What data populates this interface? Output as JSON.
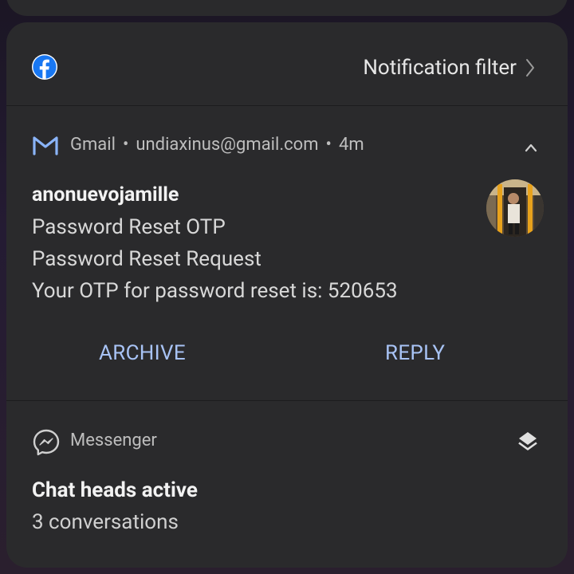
{
  "facebook_notification": {
    "app_icon": "facebook-icon",
    "filter_label": "Notification filter",
    "filter_icon": "chevron-right-icon"
  },
  "gmail_notification": {
    "app_icon": "gmail-icon",
    "app_name": "Gmail",
    "separator": "•",
    "account": "undiaxinus@gmail.com",
    "time": "4m",
    "collapse_icon": "chevron-up-icon",
    "sender": "anonuevojamille",
    "subject": "Password Reset OTP",
    "title_line": "Password Reset Request",
    "body": "Your OTP for password reset is: 520653",
    "avatar": "sender-avatar",
    "actions": {
      "archive": "ARCHIVE",
      "reply": "REPLY"
    }
  },
  "messenger_notification": {
    "app_icon": "messenger-icon",
    "app_name": "Messenger",
    "stack_icon": "layers-icon",
    "title": "Chat heads active",
    "subtitle": "3 conversations"
  },
  "colors": {
    "card_bg": "#2a2a2c",
    "action_text": "#a8c3f5",
    "facebook_blue": "#1877f2",
    "progress_blue": "#2aa3f5"
  }
}
